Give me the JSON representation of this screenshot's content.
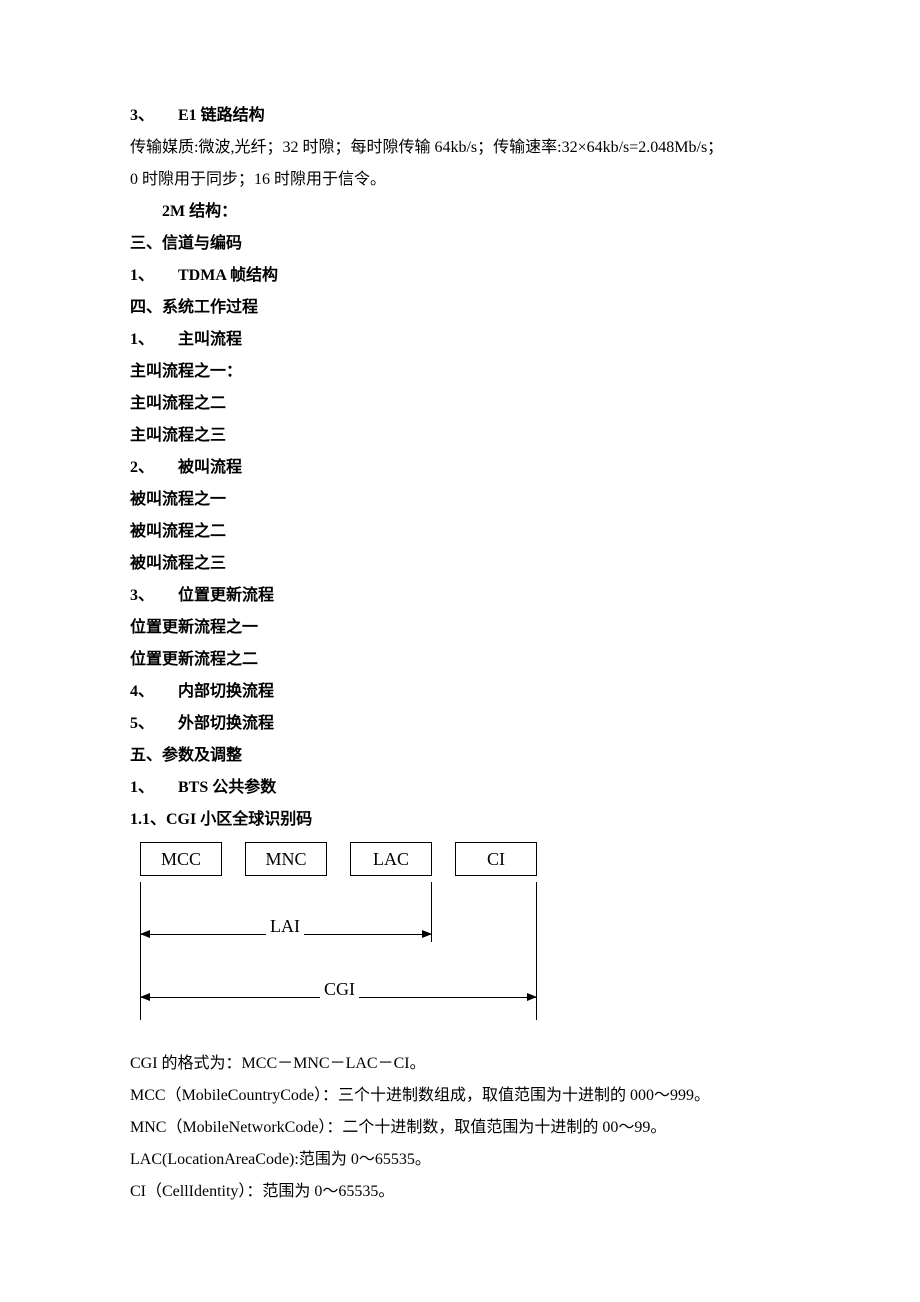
{
  "lines": {
    "l1": "3、　　E1 链路结构",
    "l2": "传输媒质:微波,光纤；32 时隙；每时隙传输 64kb/s；传输速率:32×64kb/s=2.048Mb/s；",
    "l3": "0 时隙用于同步；16 时隙用于信令。",
    "l4": "　　2M 结构：",
    "l5": "三、信道与编码",
    "l6": "1、　　TDMA 帧结构",
    "l7": "四、系统工作过程",
    "l8": "1、　　主叫流程",
    "l9": "主叫流程之一：",
    "l10": "主叫流程之二",
    "l11": "主叫流程之三",
    "l12": "2、　　被叫流程",
    "l13": "被叫流程之一",
    "l14": "被叫流程之二",
    "l15": "被叫流程之三",
    "l16": "3、　　位置更新流程",
    "l17": "位置更新流程之一",
    "l18": "位置更新流程之二",
    "l19": "4、　　内部切换流程",
    "l20": "5、　　外部切换流程",
    "l21": "五、参数及调整",
    "l22": "1、　　BTS 公共参数",
    "l23": "1.1、CGI 小区全球识别码",
    "l24": "CGI 的格式为：MCC－MNC－LAC－CI。",
    "l25": "MCC（MobileCountryCode）：三个十进制数组成，取值范围为十进制的 000～999。",
    "l26": "MNC（MobileNetworkCode）：二个十进制数，取值范围为十进制的 00～99。",
    "l27": "LAC(LocationAreaCode):范围为 0～65535。",
    "l28": "CI（CellIdentity）：范围为 0～65535。"
  },
  "diagram": {
    "boxes": [
      "MCC",
      "MNC",
      "LAC",
      "CI"
    ],
    "dims": [
      "LAI",
      "CGI"
    ]
  }
}
